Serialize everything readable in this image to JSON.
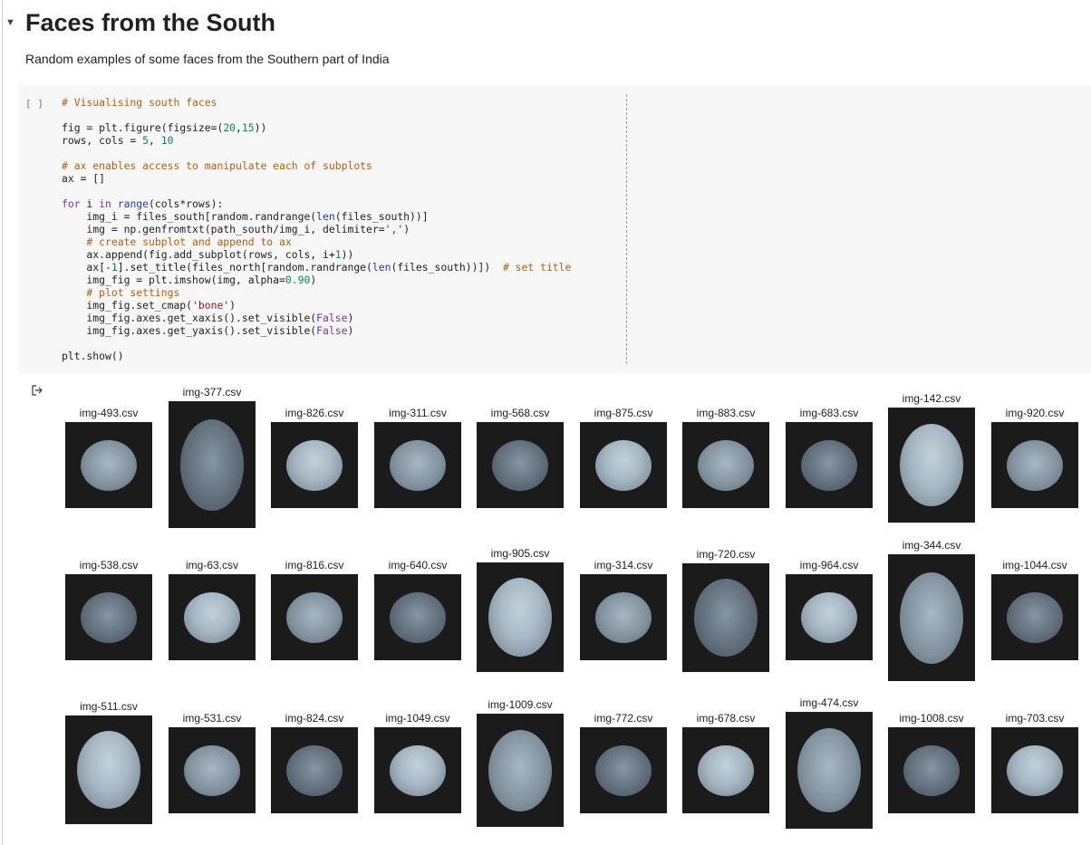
{
  "section": {
    "title": "Faces from the South",
    "description": "Random examples of some faces from the Southern part of India"
  },
  "cell": {
    "run_label": "[ ]",
    "code_lines": [
      [
        {
          "t": "# Visualising south faces",
          "c": "c-comment"
        }
      ],
      [],
      [
        {
          "t": "fig = plt.figure(figsize=("
        },
        {
          "t": "20",
          "c": "c-num"
        },
        {
          "t": ","
        },
        {
          "t": "15",
          "c": "c-num"
        },
        {
          "t": "))"
        }
      ],
      [
        {
          "t": "rows, cols = "
        },
        {
          "t": "5",
          "c": "c-num"
        },
        {
          "t": ", "
        },
        {
          "t": "10",
          "c": "c-num"
        }
      ],
      [],
      [
        {
          "t": "# ax enables access to manipulate each of subplots",
          "c": "c-comment"
        }
      ],
      [
        {
          "t": "ax = []"
        }
      ],
      [],
      [
        {
          "t": "for",
          "c": "c-kw"
        },
        {
          "t": " i "
        },
        {
          "t": "in",
          "c": "c-kw"
        },
        {
          "t": " "
        },
        {
          "t": "range",
          "c": "c-bi"
        },
        {
          "t": "(cols*rows):"
        }
      ],
      [
        {
          "t": "    img_i = files_south[random.randrange("
        },
        {
          "t": "len",
          "c": "c-bi"
        },
        {
          "t": "(files_south))]"
        }
      ],
      [
        {
          "t": "    img = np.genfromtxt(path_south/img_i, delimiter="
        },
        {
          "t": "','",
          "c": "c-str"
        },
        {
          "t": ")"
        }
      ],
      [
        {
          "t": "    # create subplot and append to ax",
          "c": "c-comment"
        }
      ],
      [
        {
          "t": "    ax.append(fig.add_subplot(rows, cols, i+"
        },
        {
          "t": "1",
          "c": "c-num"
        },
        {
          "t": "))"
        }
      ],
      [
        {
          "t": "    ax[-"
        },
        {
          "t": "1",
          "c": "c-num"
        },
        {
          "t": "].set_title(files_north[random.randrange("
        },
        {
          "t": "len",
          "c": "c-bi"
        },
        {
          "t": "(files_south))])  "
        },
        {
          "t": "# set title",
          "c": "c-comment"
        }
      ],
      [
        {
          "t": "    img_fig = plt.imshow(img, alpha="
        },
        {
          "t": "0.90",
          "c": "c-num"
        },
        {
          "t": ")"
        }
      ],
      [
        {
          "t": "    # plot settings",
          "c": "c-comment"
        }
      ],
      [
        {
          "t": "    img_fig.set_cmap("
        },
        {
          "t": "'bone'",
          "c": "c-str"
        },
        {
          "t": ")"
        }
      ],
      [
        {
          "t": "    img_fig.axes.get_xaxis().set_visible("
        },
        {
          "t": "False",
          "c": "c-kw"
        },
        {
          "t": ")"
        }
      ],
      [
        {
          "t": "    img_fig.axes.get_yaxis().set_visible("
        },
        {
          "t": "False",
          "c": "c-kw"
        },
        {
          "t": ")"
        }
      ],
      [],
      [
        {
          "t": "plt.show()"
        }
      ]
    ]
  },
  "output": {
    "rows": [
      [
        "img-493.csv",
        "img-377.csv",
        "img-826.csv",
        "img-311.csv",
        "img-568.csv",
        "img-875.csv",
        "img-883.csv",
        "img-683.csv",
        "img-142.csv",
        "img-920.csv"
      ],
      [
        "img-538.csv",
        "img-63.csv",
        "img-816.csv",
        "img-640.csv",
        "img-905.csv",
        "img-314.csv",
        "img-720.csv",
        "img-964.csv",
        "img-344.csv",
        "img-1044.csv"
      ],
      [
        "img-511.csv",
        "img-531.csv",
        "img-824.csv",
        "img-1049.csv",
        "img-1009.csv",
        "img-772.csv",
        "img-678.csv",
        "img-474.csv",
        "img-1008.csv",
        "img-703.csv"
      ]
    ]
  },
  "colors": {
    "image_background": "#1b1b1b",
    "face_tone_light": "#a7b8c4",
    "face_tone_dark": "#55606d"
  }
}
